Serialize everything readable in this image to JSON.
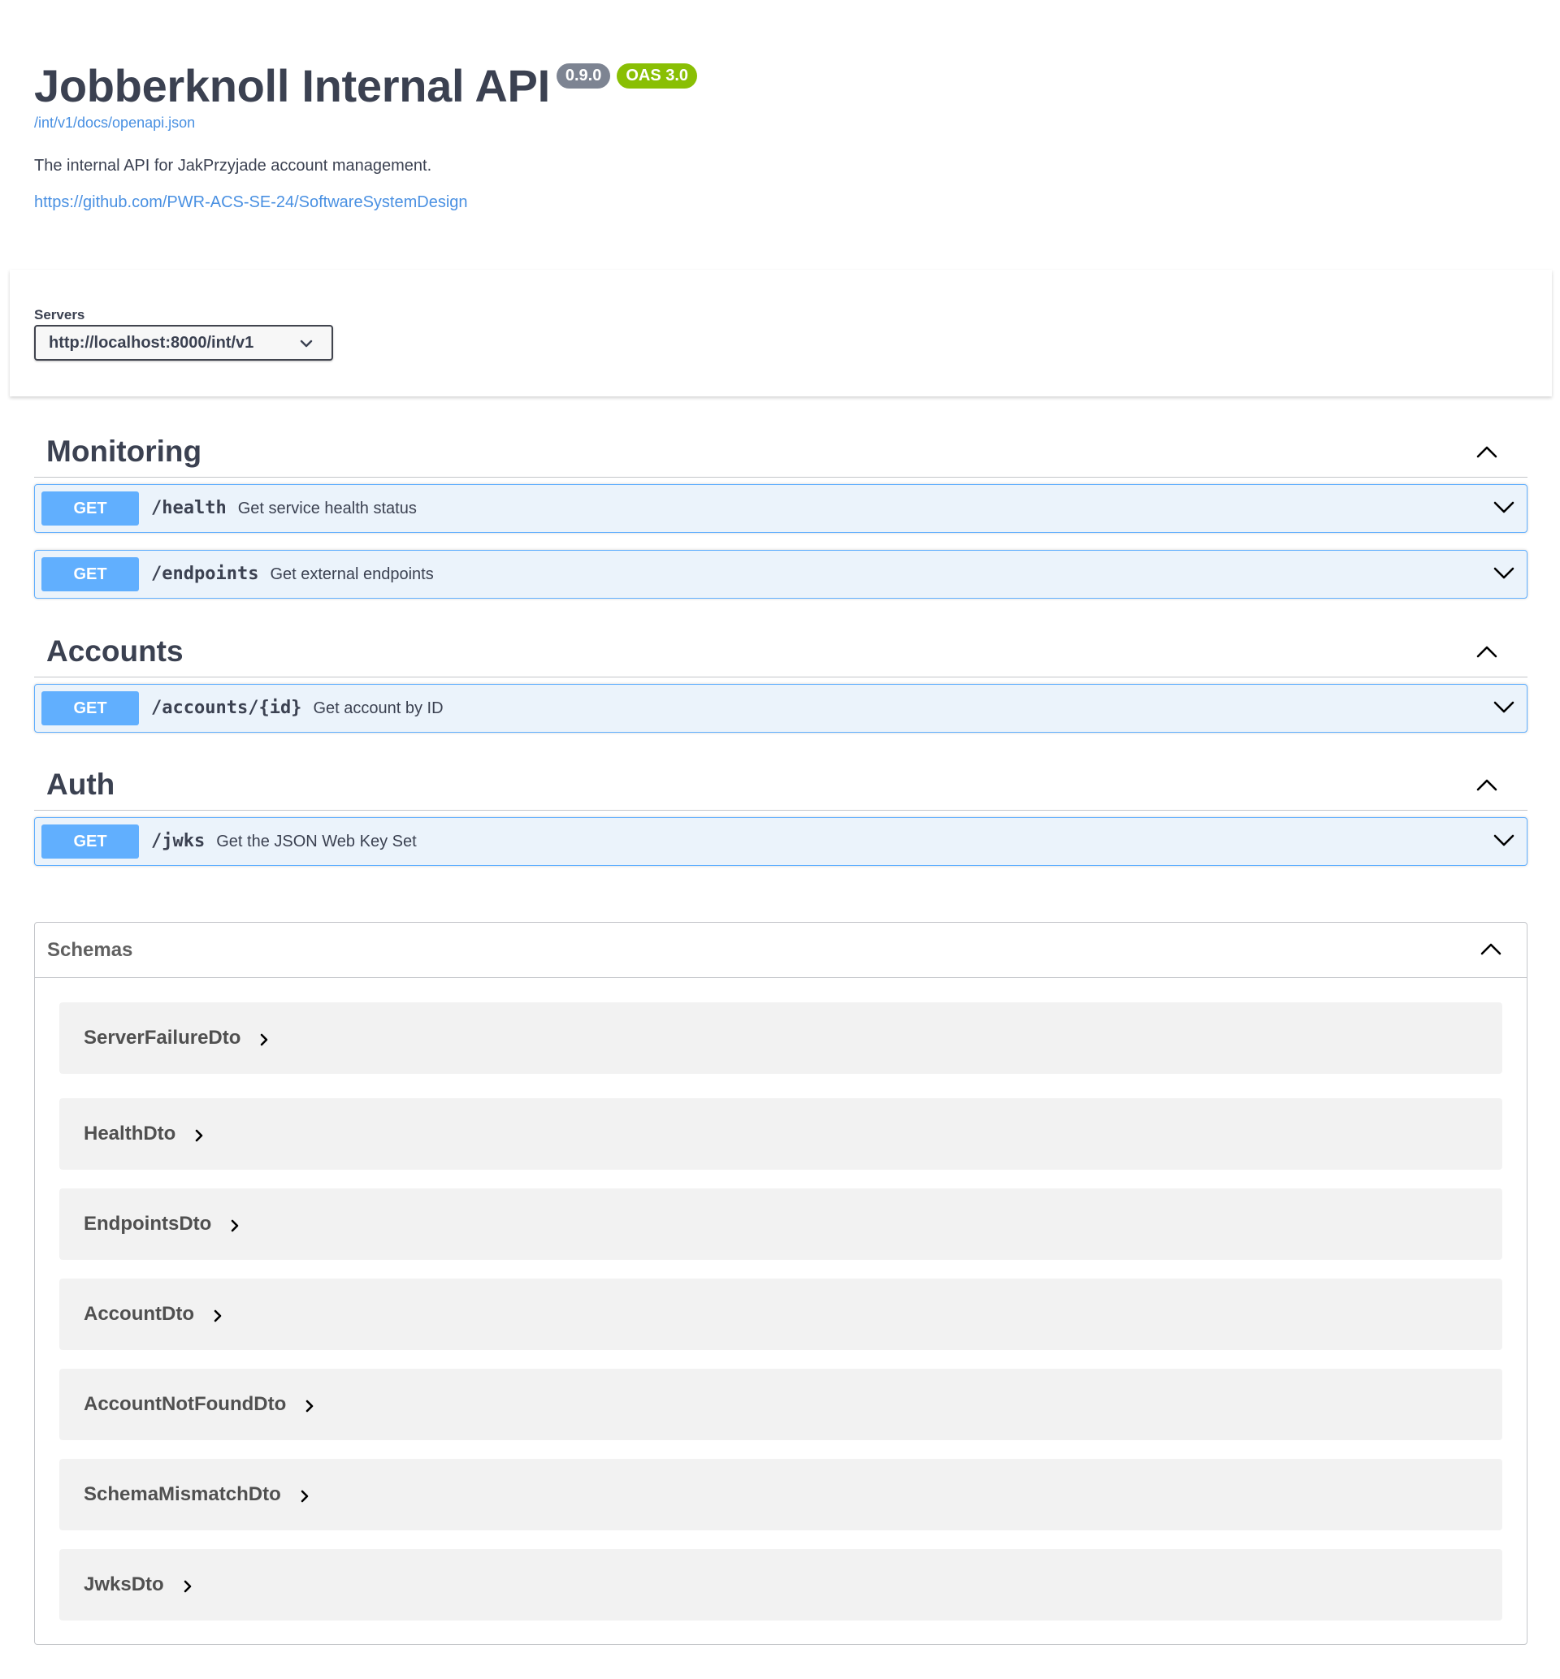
{
  "info": {
    "title": "Jobberknoll Internal API",
    "version_badge": "0.9.0",
    "oas_badge": "OAS 3.0",
    "spec_url": "/int/v1/docs/openapi.json",
    "description": "The internal API for JakPrzyjade account management.",
    "repo_url": "https://github.com/PWR-ACS-SE-24/SoftwareSystemDesign"
  },
  "servers": {
    "label": "Servers",
    "selected": "http://localhost:8000/int/v1"
  },
  "tags": [
    {
      "name": "Monitoring",
      "operations": [
        {
          "method": "GET",
          "path": "/health",
          "summary": "Get service health status"
        },
        {
          "method": "GET",
          "path": "/endpoints",
          "summary": "Get external endpoints"
        }
      ]
    },
    {
      "name": "Accounts",
      "operations": [
        {
          "method": "GET",
          "path": "/accounts/{id}",
          "summary": "Get account by ID"
        }
      ]
    },
    {
      "name": "Auth",
      "operations": [
        {
          "method": "GET",
          "path": "/jwks",
          "summary": "Get the JSON Web Key Set"
        }
      ]
    }
  ],
  "schemas": {
    "title": "Schemas",
    "items": [
      "ServerFailureDto",
      "HealthDto",
      "EndpointsDto",
      "AccountDto",
      "AccountNotFoundDto",
      "SchemaMismatchDto",
      "JwksDto"
    ]
  },
  "colors": {
    "get_method": "#61affe",
    "get_background": "#ebf3fb",
    "link": "#4990e2",
    "version_badge": "#7d8492",
    "oas_badge": "#89bf04"
  },
  "icons": {
    "tag_toggle": "chevron-up-icon",
    "operation_toggle": "chevron-down-icon",
    "schema_expand": "chevron-right-icon",
    "server_select": "chevron-down-icon"
  }
}
